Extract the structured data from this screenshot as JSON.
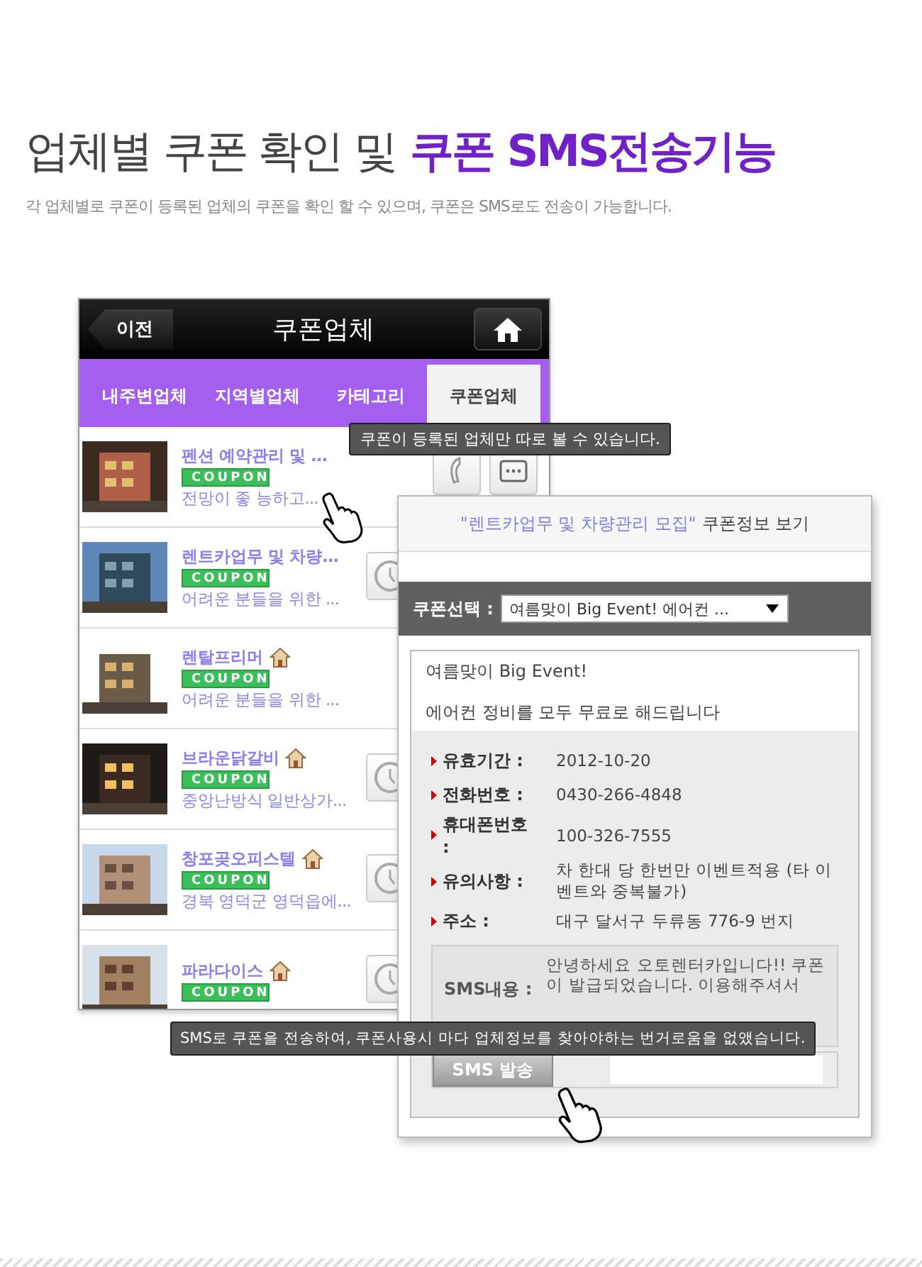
{
  "headline": {
    "normal": "업체별 쿠폰 확인 및",
    "highlight": "쿠폰 SMS전송기능"
  },
  "subheadline": "각 업체별로 쿠폰이 등록된 업체의 쿠폰을 확인 할 수 있으며, 쿠폰은 SMS로도 전송이 가능합니다.",
  "phone": {
    "back_button": "이전",
    "title": "쿠폰업체",
    "tabs": [
      {
        "label": "내주변업체",
        "selected": false
      },
      {
        "label": "지역별업체",
        "selected": false
      },
      {
        "label": "카테고리",
        "selected": false
      },
      {
        "label": "쿠폰업체",
        "selected": true
      }
    ],
    "tooltip": "쿠폰이 등록된 업체만 따로 볼 수 있습니다.",
    "companies": [
      {
        "name": "펜션 예약관리 및 ...",
        "home": false,
        "badge": "COUPON",
        "description": "전망이 좋 능하고...",
        "kind": "call"
      },
      {
        "name": "렌트카업무 및 차량...",
        "home": false,
        "badge": "COUPON",
        "description": "어려운 분들을 위한 ...",
        "kind": "timer"
      },
      {
        "name": "렌탈프리머",
        "home": true,
        "badge": "COUPON",
        "description": "어려운 분들을 위한 ...",
        "kind": "plain"
      },
      {
        "name": "브라운닭갈비",
        "home": true,
        "badge": "COUPON",
        "description": "중앙난방식 일반상가...",
        "kind": "timer"
      },
      {
        "name": "창포곶오피스텔",
        "home": true,
        "badge": "COUPON",
        "description": "경북 영덕군 영덕읍에...",
        "kind": "timer"
      },
      {
        "name": "파라다이스",
        "home": true,
        "badge": "COUPON",
        "kind": "timer"
      }
    ]
  },
  "coupon_popup": {
    "company": "\"렌트카업무 및 차량관리 모집\"",
    "title": "쿠폰정보 보기",
    "select_label": "쿠폰선택 :",
    "select_value": "여름맞이 Big Event! 에어컨 ...",
    "headline": "여름맞이 Big Event!",
    "body": "에어컨 정비를 모두 무료로 해드립니다",
    "details": [
      {
        "label": "유효기간 :",
        "value": "2012-10-20"
      },
      {
        "label": "전화번호 :",
        "value": "0430-266-4848"
      },
      {
        "label": "휴대폰번호 :",
        "value": "100-326-7555"
      },
      {
        "label": "유의사항 :",
        "value": "차 한대 당 한번만 이벤트적용 (타 이벤트와 중복불가)"
      },
      {
        "label": "주소 :",
        "value": "대구 달서구 두류동 776-9 번지"
      }
    ],
    "sms_label": "SMS내용 :",
    "sms_text": "안녕하세요 오토렌터카입니다!! 쿠폰이 발급되었습니다. 이용해주셔서",
    "send_button": "SMS 발송"
  },
  "sms_tooltip": "SMS로 쿠폰을 전송하여, 쿠폰사용시 마다 업체정보를 찾아야하는 번거로움을 없앴습니다."
}
